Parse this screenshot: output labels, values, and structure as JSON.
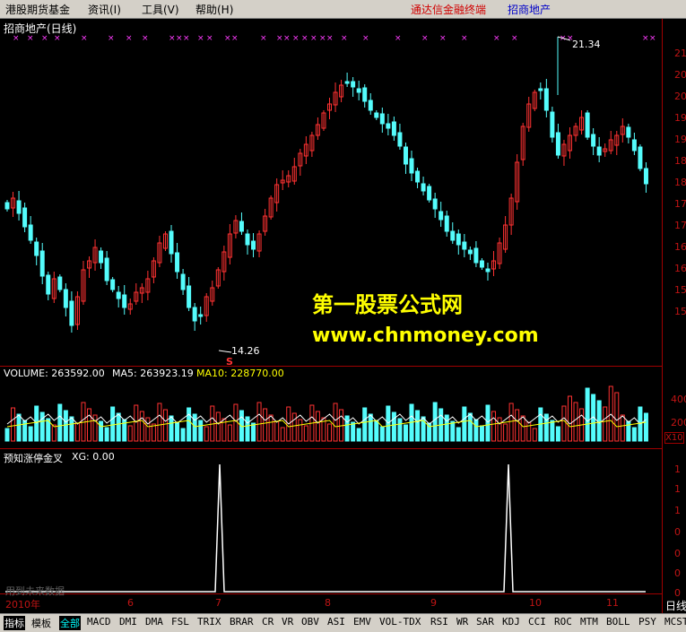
{
  "menu": {
    "items": [
      {
        "label": "港股期货基金"
      },
      {
        "label": "资讯(I)"
      },
      {
        "label": "工具(V)"
      },
      {
        "label": "帮助(H)"
      }
    ],
    "broker": "通达信金融终端",
    "stock": "招商地产"
  },
  "chart": {
    "title": "招商地产(日线)",
    "marker_symbol": "××",
    "high_label": "21.34",
    "low_label": "14.26",
    "s_marker": "S",
    "y_ticks": [
      "21",
      "20",
      "20",
      "19",
      "19",
      "18",
      "18",
      "17",
      "17",
      "16",
      "16",
      "15",
      "15"
    ],
    "x_labels": [
      "2010年",
      "6",
      "7",
      "8",
      "9",
      "10",
      "11"
    ],
    "colors": {
      "up": "#ff3232",
      "down": "#54fcfc",
      "axis": "#a00000",
      "ma5": "#ffffff",
      "ma10": "#ffff00"
    }
  },
  "volume": {
    "label": "VOLUME: 263592.00",
    "ma5": "MA5: 263923.19",
    "ma10": "MA10: 228770.00",
    "ticks": [
      "400",
      "200"
    ],
    "unit": "X10"
  },
  "indicator": {
    "title": "预知涨停金叉",
    "value": "XG: 0.00",
    "ticks": [
      "1",
      "1",
      "1",
      "0",
      "0",
      "0",
      "0"
    ],
    "note": "用到未来数据"
  },
  "watermark": {
    "line1": "第一股票公式网",
    "line2": "www.chnmoney.com"
  },
  "corner": "日线",
  "tabs": [
    "指标",
    "模板",
    "全部",
    "MACD",
    "DMI",
    "DMA",
    "FSL",
    "TRIX",
    "BRAR",
    "CR",
    "VR",
    "OBV",
    "ASI",
    "EMV",
    "VOL-TDX",
    "RSI",
    "WR",
    "SAR",
    "KDJ",
    "CCI",
    "ROC",
    "MTM",
    "BOLL",
    "PSY",
    "MCST"
  ]
}
